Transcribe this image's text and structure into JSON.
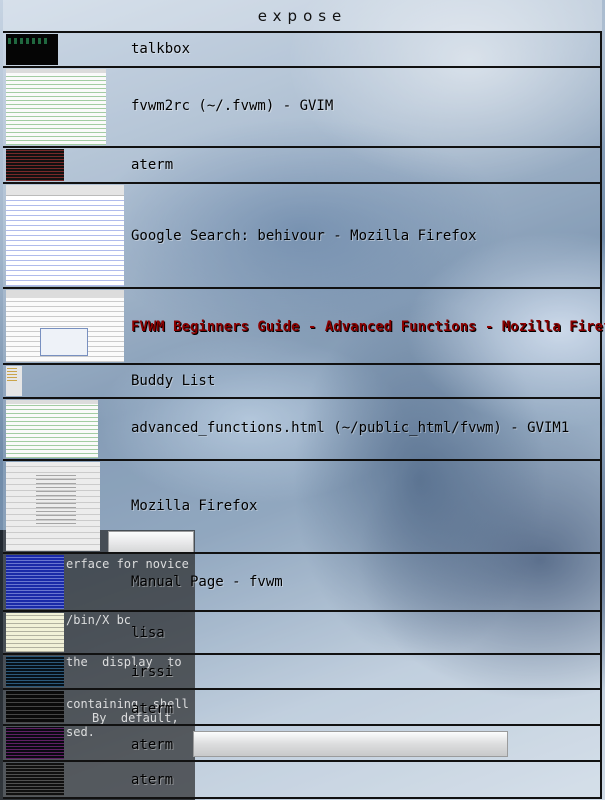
{
  "menu": {
    "title": "expose",
    "items": [
      {
        "label": "talkbox",
        "thumb": "dark-terminal-thumbnail"
      },
      {
        "label": "fvwm2rc (~/.fvwm) - GVIM",
        "thumb": "gvim-thumbnail"
      },
      {
        "label": "aterm",
        "thumb": "terminal-thumbnail"
      },
      {
        "label": "Google Search: behivour - Mozilla Firefox",
        "thumb": "browser-thumbnail"
      },
      {
        "label": "FVWM Beginners Guide - Advanced Functions - Mozilla Firefox",
        "thumb": "browser-thumbnail",
        "selected": true
      },
      {
        "label": "Buddy List",
        "thumb": "buddy-list-thumbnail"
      },
      {
        "label": "advanced_functions.html (~/public_html/fvwm) - GVIM1",
        "thumb": "gvim-thumbnail"
      },
      {
        "label": "Mozilla Firefox",
        "thumb": "browser-thumbnail"
      },
      {
        "label": "Manual Page - fvwm",
        "thumb": "manpage-thumbnail"
      },
      {
        "label": "lisa",
        "thumb": "lisa-thumbnail"
      },
      {
        "label": "irssi",
        "thumb": "irc-thumbnail"
      },
      {
        "label": "aterm",
        "thumb": "terminal-thumbnail"
      },
      {
        "label": "aterm",
        "thumb": "terminal-thumbnail"
      },
      {
        "label": "aterm",
        "thumb": "terminal-thumbnail"
      }
    ]
  },
  "background_terminal": {
    "lines": [
      "erface for novice",
      "/bin/X bc",
      "the  display  to",
      "containing  shell",
      "By  default,",
      "sed."
    ]
  },
  "colors": {
    "selected_label": "#8a0000",
    "separator": "#111111"
  }
}
